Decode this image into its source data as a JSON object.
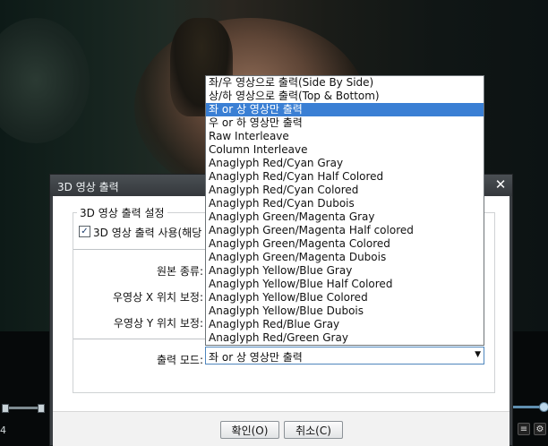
{
  "dialog": {
    "title": "3D 영상 출력",
    "close_glyph": "✕",
    "group_title": "3D 영상 출력 설정",
    "enable_checkbox": {
      "label": "3D 영상 출력 사용(해당",
      "checked": true,
      "check_glyph": "✓"
    },
    "fields": {
      "source_type": "원본 종류:",
      "right_x": "우영상 X 위치 보정:",
      "right_y": "우영상 Y 위치 보정:",
      "output_mode": "출력 모드:"
    },
    "output_mode_value": "좌 or 상 영상만 출력",
    "dropdown_arrow": "▼",
    "buttons": {
      "ok": "확인(O)",
      "cancel": "취소(C)"
    }
  },
  "dropdown_options": [
    "좌/우 영상으로 출력(Side By Side)",
    "상/하 영상으로 출력(Top & Bottom)",
    "좌 or 상 영상만 출력",
    "우 or 하 영상만 출력",
    "Raw Interleave",
    "Column Interleave",
    "Anaglyph Red/Cyan Gray",
    "Anaglyph Red/Cyan Half Colored",
    "Anaglyph Red/Cyan Colored",
    "Anaglyph Red/Cyan Dubois",
    "Anaglyph Green/Magenta Gray",
    "Anaglyph Green/Magenta Half colored",
    "Anaglyph Green/Magenta Colored",
    "Anaglyph Green/Magenta Dubois",
    "Anaglyph Yellow/Blue Gray",
    "Anaglyph Yellow/Blue Half Colored",
    "Anaglyph Yellow/Blue Colored",
    "Anaglyph Yellow/Blue Dubois",
    "Anaglyph Red/Blue Gray",
    "Anaglyph Red/Green Gray"
  ],
  "selected_index": 2,
  "player": {
    "left_number": "4"
  },
  "colors": {
    "highlight": "#3a7fd4",
    "dialog_frame": "#3b3f43"
  }
}
